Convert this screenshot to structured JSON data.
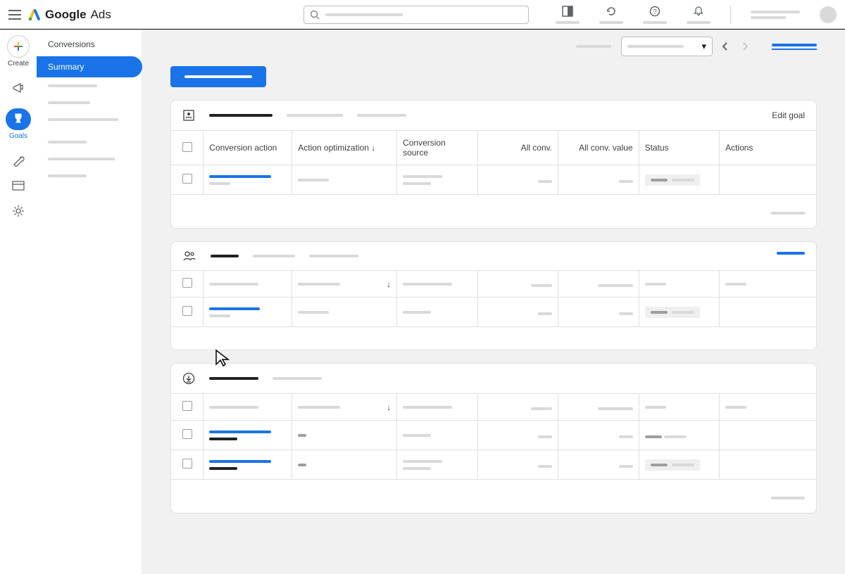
{
  "header": {
    "product_name_1": "Google",
    "product_name_2": "Ads"
  },
  "rail": {
    "create_label": "Create",
    "goals_label": "Goals"
  },
  "sidebar": {
    "crumb": "Conversions",
    "items": [
      "Summary"
    ]
  },
  "main": {
    "cards": [
      {
        "edit_label": "Edit goal",
        "columns": [
          "Conversion action",
          "Action optimization",
          "Conversion source",
          "All conv.",
          "All conv. value",
          "Status",
          "Actions"
        ]
      },
      {
        "columns": [
          "",
          "",
          "",
          "",
          "",
          "",
          ""
        ]
      },
      {
        "columns": [
          "",
          "",
          "",
          "",
          "",
          "",
          ""
        ]
      }
    ]
  }
}
